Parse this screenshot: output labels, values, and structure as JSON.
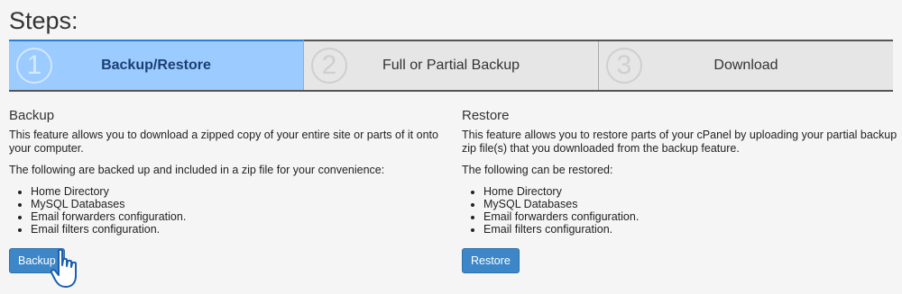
{
  "page": {
    "title": "Steps:"
  },
  "steps": [
    {
      "number": "1",
      "label": "Backup/Restore",
      "active": true
    },
    {
      "number": "2",
      "label": "Full or Partial Backup",
      "active": false
    },
    {
      "number": "3",
      "label": "Download",
      "active": false
    }
  ],
  "backup": {
    "heading": "Backup",
    "description": "This feature allows you to download a zipped copy of your entire site or parts of it onto your computer.",
    "note": "The following are backed up and included in a zip file for your convenience:",
    "items": [
      "Home Directory",
      "MySQL Databases",
      "Email forwarders configuration.",
      "Email filters configuration."
    ],
    "button_label": "Backup"
  },
  "restore": {
    "heading": "Restore",
    "description": "This feature allows you to restore parts of your cPanel by uploading your partial backup zip file(s) that you downloaded from the backup feature.",
    "note": "The following can be restored:",
    "items": [
      "Home Directory",
      "MySQL Databases",
      "Email forwarders configuration.",
      "Email filters configuration."
    ],
    "button_label": "Restore"
  },
  "colors": {
    "active_step": "#9ccbff",
    "inactive_step": "#e6e6e6",
    "button": "#3d87c9"
  },
  "cursor": {
    "icon": "hand-pointer-icon"
  }
}
